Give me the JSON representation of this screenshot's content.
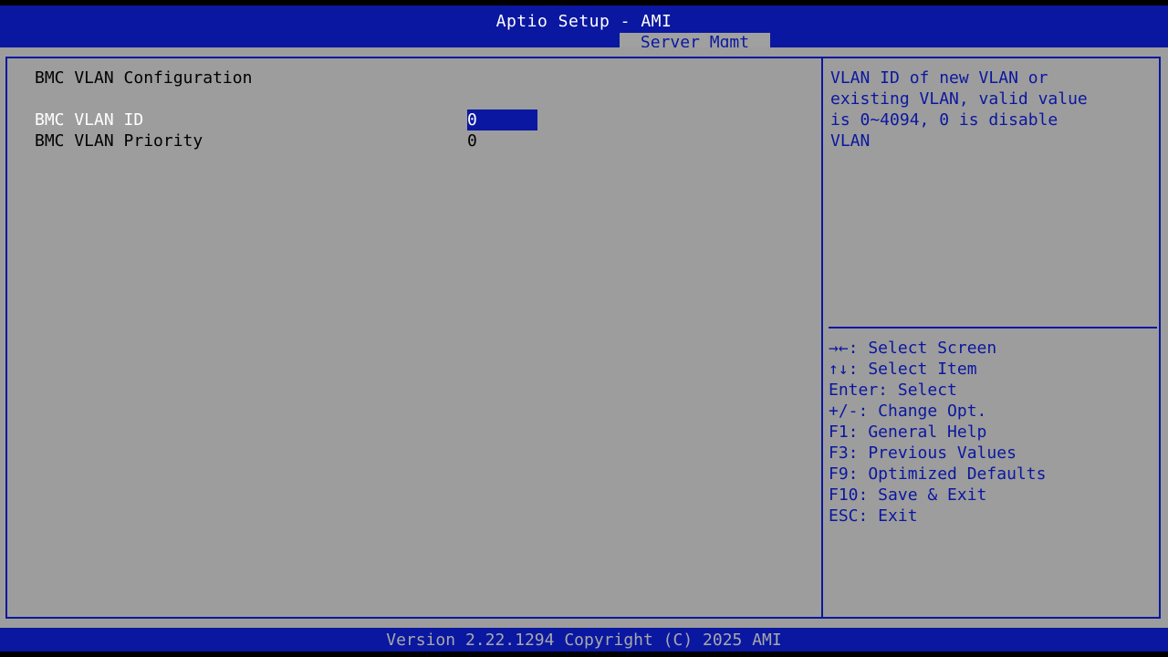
{
  "header": {
    "title": "Aptio Setup - AMI",
    "active_tab": "Server Mgmt"
  },
  "main": {
    "section_title": "BMC VLAN Configuration",
    "rows": [
      {
        "label": "BMC VLAN ID",
        "value": "0",
        "selected": true
      },
      {
        "label": "BMC VLAN Priority",
        "value": "0",
        "selected": false
      }
    ]
  },
  "help": {
    "text": "VLAN ID of new VLAN or\nexisting VLAN, valid value\nis 0~4094, 0 is disable\nVLAN"
  },
  "keys": [
    "→←: Select Screen",
    "↑↓: Select Item",
    "Enter: Select",
    "+/-: Change Opt.",
    "F1: General Help",
    "F3: Previous Values",
    "F9: Optimized Defaults",
    "F10: Save & Exit",
    "ESC: Exit"
  ],
  "footer": {
    "text": "Version 2.22.1294 Copyright (C) 2025 AMI"
  },
  "colors": {
    "bios_blue": "#0a17a0",
    "panel_gray": "#9d9d9d"
  }
}
